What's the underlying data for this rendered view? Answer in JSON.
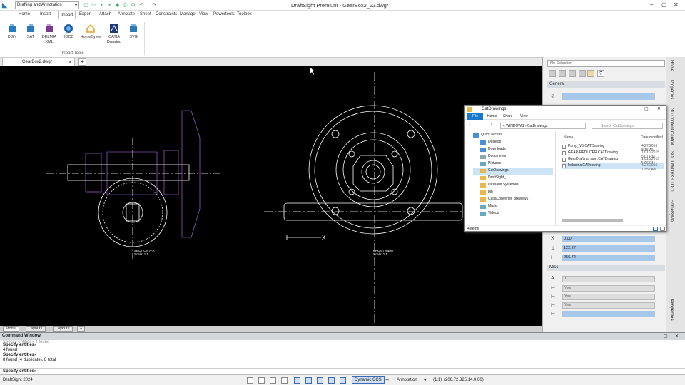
{
  "titlebar": {
    "workspace": "Drafting and Annotation",
    "app_title": "DraftSight Premium - GearBox2_v2.dwg*"
  },
  "menus": [
    "Home",
    "Insert",
    "Import",
    "Export",
    "Attach",
    "Annotate",
    "Sheet",
    "Constraints",
    "Manage",
    "View",
    "Powertools",
    "Toolbox"
  ],
  "active_menu": "Import",
  "ribbon": {
    "tools": [
      {
        "label": "DGN",
        "icon": "dgn-icon"
      },
      {
        "label": "SAT",
        "icon": "sat-icon"
      },
      {
        "label": "DELMIA XML",
        "icon": "delmia-xml-icon"
      },
      {
        "label": "3DCC",
        "icon": "3dcc-icon"
      },
      {
        "label": "HomeByMe",
        "icon": "homebyme-icon"
      },
      {
        "label": "CATIA Drawing",
        "icon": "catia-icon"
      },
      {
        "label": "SVG",
        "icon": "svg-icon"
      }
    ],
    "group_label": "Import Tools"
  },
  "document_tab": "GearBox2.dwg*",
  "layout_tabs": [
    "Model",
    "Layout1",
    "Layout2"
  ],
  "drawing": {
    "left_view_label": "SECTION A-A",
    "left_view_scale": "Scale: 1:1",
    "right_view_label": "FRONT VIEW",
    "right_view_scale": "Scale: 1:1"
  },
  "command_window": {
    "title": "Command Window",
    "lines": [
      {
        "text": "Specify entities» 4 found",
        "bold": false
      },
      {
        "text": "Specify entities»",
        "bold": true
      },
      {
        "text": "4 found",
        "bold": false
      },
      {
        "text": "Specify entities»",
        "bold": true
      },
      {
        "text": "8 found (4 duplicate), 8 total",
        "bold": false
      }
    ],
    "prompt": "Specify entities»"
  },
  "status": {
    "app": "DraftSight 2024",
    "ccs": "Dynamic CCS",
    "annotation": "Annotation",
    "scale": "(1:1)",
    "coords": "(206.72,325.14,0.00)"
  },
  "properties": {
    "selection": "No Selection",
    "general_section": "General",
    "misc_section": "Misc",
    "geometry": [
      {
        "icon": "X",
        "value": "0.00"
      },
      {
        "icon": "⊥",
        "value": "122.27"
      },
      {
        "icon": "⊢",
        "value": "256.72"
      }
    ],
    "misc": [
      {
        "value": "1:1"
      },
      {
        "value": "Yes"
      },
      {
        "value": "Yes"
      },
      {
        "value": "Yes"
      }
    ]
  },
  "side_tabs": [
    "Home",
    "Properties",
    "3D Content Central",
    "SOLIDWORKS TOOL",
    "HomeByMe"
  ],
  "side_tab_bottom": "Properties",
  "explorer": {
    "title": "CatDrawings",
    "tabs": [
      "File",
      "Home",
      "Share",
      "View"
    ],
    "address": "« WINDOWS › CatDrawings",
    "search": "Search CatDrawings",
    "nav": [
      "Quick access",
      "Desktop",
      "Downloads",
      "Documents",
      "Pictures",
      "CatDrawings",
      "DraftSight_",
      "Dassault Systemes",
      "bin",
      "CatiaConverter_preview1",
      "Music",
      "Videos"
    ],
    "nav_selected": "CatDrawings",
    "columns": {
      "name": "Name",
      "date": "Date modified"
    },
    "files": [
      {
        "name": "Pump_V5.CATDrawing",
        "date": "4/27/2016 8:15 AM"
      },
      {
        "name": "GEAR-REDUCER.CATDrawing",
        "date": "12/10/2015 5:07 PM"
      },
      {
        "name": "GearDrafting_sam.CATDrawing",
        "date": "12/10/2015 5:06 PM"
      },
      {
        "name": "IndustrialCADrawing",
        "date": "4/27/2016 10:52 AM"
      }
    ],
    "file_selected": 3,
    "status": "4 items"
  },
  "colors": {
    "canvas": "#000000",
    "accent": "#1979ca",
    "field": "#a8c8ea"
  }
}
